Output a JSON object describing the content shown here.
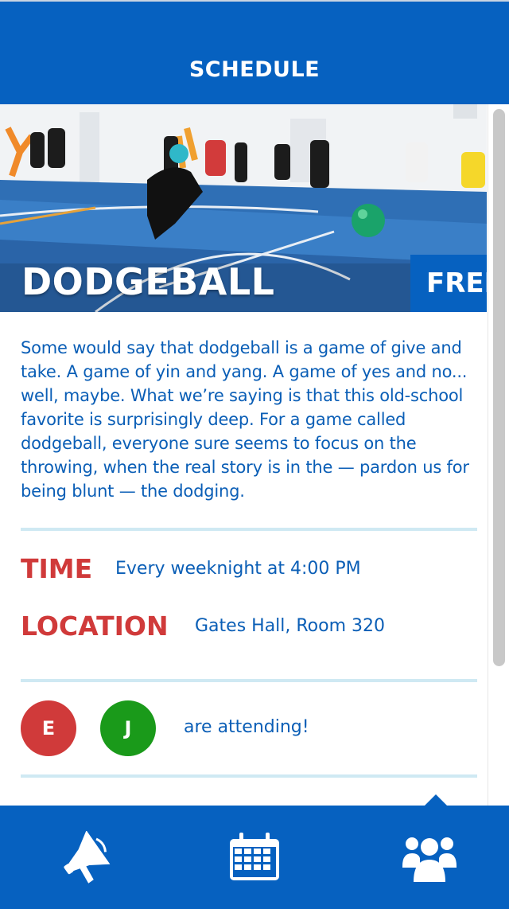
{
  "header": {
    "title": "SCHEDULE"
  },
  "event": {
    "title": "DODGEBALL",
    "price": "FREE",
    "description": "Some would say that dodgeball is a game of give and take. A game of yin and yang. A game of yes and no... well, maybe. What we’re saying is that this old-school favorite is surprisingly deep. For a game called dodgeball, everyone sure seems to focus on the throwing, when the real story is in the — pardon us for being blunt — the dodging.",
    "time_label": "TIME",
    "time_value": "Every weeknight at 4:00 PM",
    "location_label": "LOCATION",
    "location_value": "Gates Hall, Room 320"
  },
  "attendees": {
    "people": [
      {
        "initial": "E",
        "color": "#d03a3a"
      },
      {
        "initial": "J",
        "color": "#1a9a1a"
      }
    ],
    "text": "are attending!"
  },
  "bottom_nav": {
    "items": [
      {
        "icon": "megaphone-icon"
      },
      {
        "icon": "calendar-icon"
      },
      {
        "icon": "group-icon"
      }
    ],
    "active_index": 2
  },
  "colors": {
    "primary": "#0661c0",
    "accent_red": "#d03a3a",
    "text_blue": "#0a5eb6",
    "divider": "#cfe9f3"
  }
}
